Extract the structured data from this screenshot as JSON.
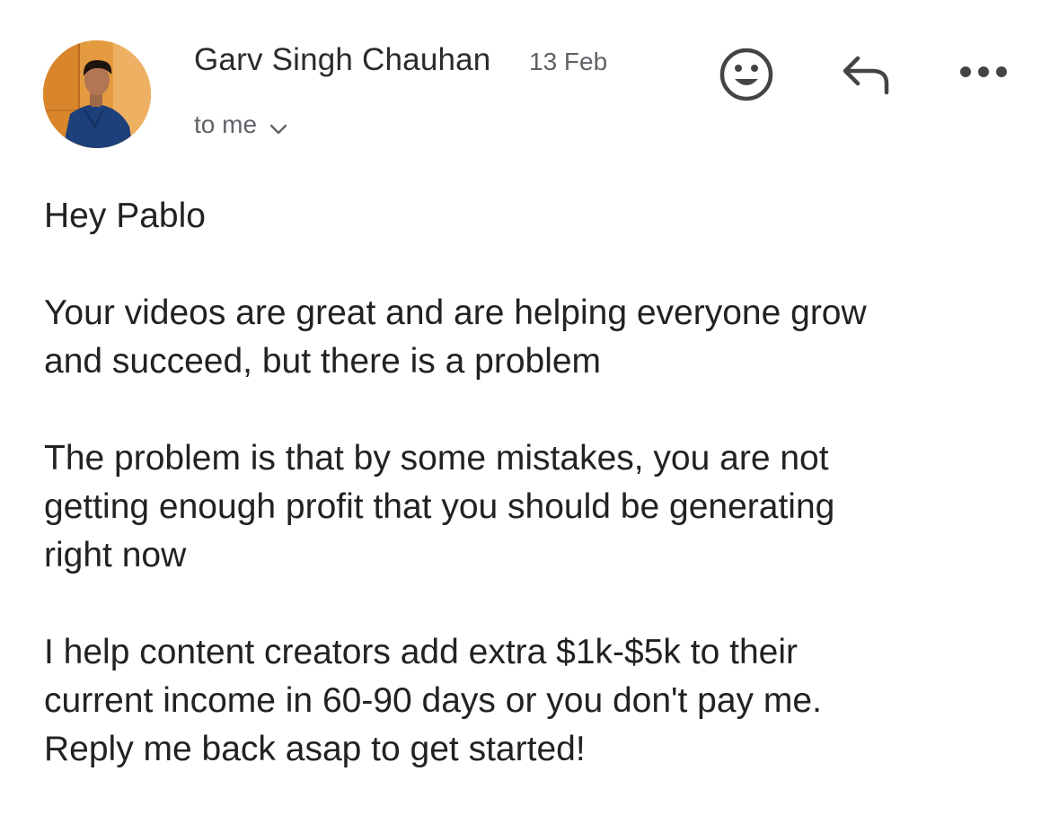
{
  "email": {
    "sender": "Garv Singh Chauhan",
    "date": "13 Feb",
    "recipient": "to me",
    "icons": {
      "avatar": "avatar-photo",
      "recipient_toggle": "chevron-down-icon",
      "emoji": "smiley-icon",
      "reply": "reply-icon",
      "more": "more-horizontal-icon"
    },
    "body": {
      "greeting": "Hey Pablo",
      "paragraph_1": "Your videos are great and are helping everyone grow\nand succeed, but there is a problem",
      "paragraph_2": "The problem is that by some mistakes, you are not\ngetting enough profit that you should be generating\nright now",
      "paragraph_3": "I help content creators add extra $1k-$5k to their\ncurrent income in 60-90 days or you don't pay me.\nReply me back asap to get started!"
    }
  },
  "colors": {
    "text_primary": "#222222",
    "text_secondary": "#5f6368",
    "icon": "#444444",
    "avatar_bg": "#e8a24a"
  }
}
